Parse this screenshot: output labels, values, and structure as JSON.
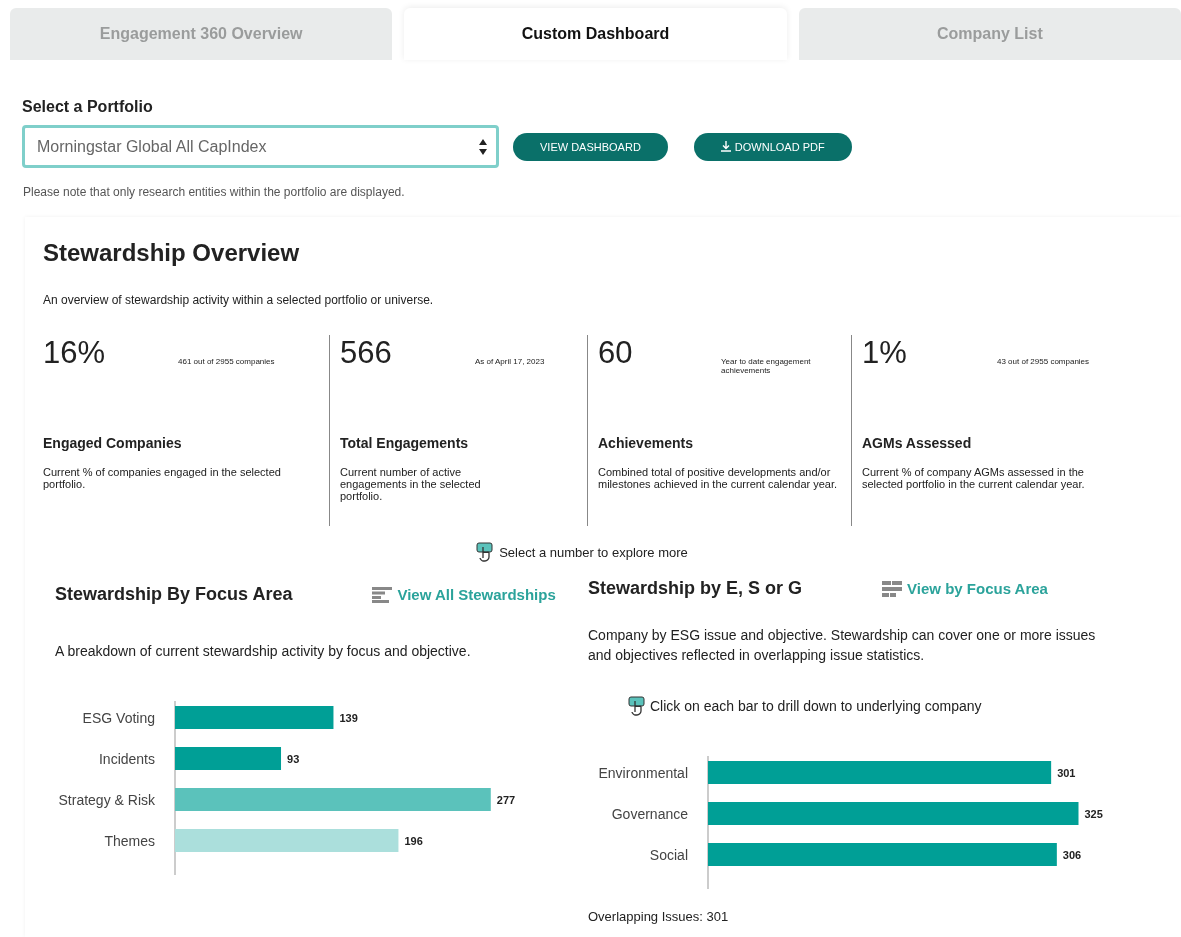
{
  "tabs": [
    {
      "label": "Engagement 360 Overview",
      "selected": false
    },
    {
      "label": "Custom Dashboard",
      "selected": true
    },
    {
      "label": "Company List",
      "selected": false
    }
  ],
  "portfolio": {
    "label": "Select a Portfolio",
    "value": "Morningstar Global All CapIndex",
    "buttons": [
      {
        "label": "VIEW DASHBOARD",
        "kind": "plain"
      },
      {
        "label": "DOWNLOAD PDF",
        "kind": "download"
      }
    ],
    "note": "Please note that only research entities within the portfolio are displayed."
  },
  "overview": {
    "title": "Stewardship Overview",
    "subtitle": "An overview of stewardship activity within a selected portfolio or universe.",
    "stats": [
      {
        "value": "16%",
        "detail": "461 out of 2955 companies",
        "label": "Engaged Companies",
        "description": "Current % of companies engaged in the selected portfolio."
      },
      {
        "value": "566",
        "detail": "As of April 17, 2023",
        "label": "Total Engagements",
        "description": "Current number of active engagements in the selected portfolio."
      },
      {
        "value": "60",
        "detail": "Year to date engagement achievements",
        "label": "Achievements",
        "description": "Combined total of positive developments and/or milestones achieved in the current calendar year."
      },
      {
        "value": "1%",
        "detail": "43 out of 2955 companies",
        "label": "AGMs Assessed",
        "description": "Current % of company AGMs assessed in the selected portfolio in the current calendar year."
      }
    ],
    "hint": "Select a number to explore more"
  },
  "panels": [
    {
      "title": "Stewardship By Focus Area",
      "link": "View All Stewardships",
      "description": "A breakdown of current stewardship activity by focus and objective.",
      "chart_data": {
        "type": "bar",
        "orientation": "horizontal",
        "stacked": true,
        "data_labels": true,
        "categories": [
          "ESG Voting",
          "Incidents",
          "Strategy & Risk",
          "Themes"
        ],
        "series": [
          {
            "color": "#009f96",
            "values": [
              139,
              93,
              null,
              null
            ]
          },
          {
            "color": "#5bc2bb",
            "values": [
              null,
              null,
              277,
              null
            ]
          },
          {
            "color": "#abdfdc",
            "values": [
              null,
              null,
              null,
              196
            ]
          }
        ]
      }
    },
    {
      "title": "Stewardship by E, S or G",
      "link": "View by Focus Area",
      "description": "Company by ESG issue and objective. Stewardship can cover one or more issues and objectives reflected in overlapping issue statistics.",
      "hint": "Click on each bar to drill down to underlying company",
      "chart_data": {
        "type": "bar",
        "orientation": "horizontal",
        "stacked": true,
        "data_labels": true,
        "categories": [
          "Environmental",
          "Governance",
          "Social"
        ],
        "series": [
          {
            "color": "#009f96",
            "values": [
              301,
              325,
              306
            ]
          }
        ]
      },
      "footer": "Overlapping Issues: 301"
    }
  ]
}
